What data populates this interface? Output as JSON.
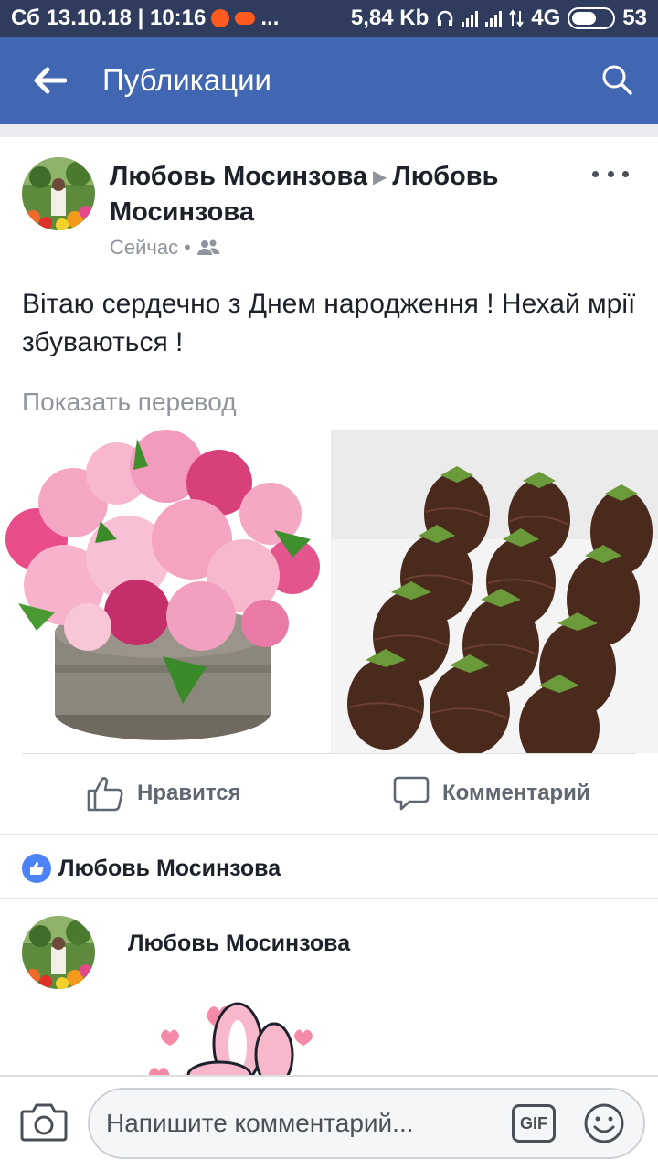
{
  "status_bar": {
    "datetime": "Сб 13.10.18 | 10:16",
    "dots": "...",
    "speed": "5,84 Kb",
    "network": "4G",
    "battery": "53"
  },
  "app_bar": {
    "title": "Публикации"
  },
  "post": {
    "author": "Любовь Мосинзова",
    "target": "Любовь Мосинзова",
    "time": "Сейчас",
    "text": "Вітаю сердечно з Днем народження ! Нехай мрії збуваються !",
    "translate_link": "Показать перевод"
  },
  "actions": {
    "like": "Нравится",
    "comment": "Комментарий"
  },
  "likers": {
    "name": "Любовь Мосинзова"
  },
  "comment": {
    "author": "Любовь Мосинзова"
  },
  "composer": {
    "placeholder": "Напишите комментарий...",
    "gif": "GIF"
  },
  "colors": {
    "brand": "#4267b2",
    "status_bar": "#2f3c5e",
    "like_badge": "#4c82f7"
  }
}
